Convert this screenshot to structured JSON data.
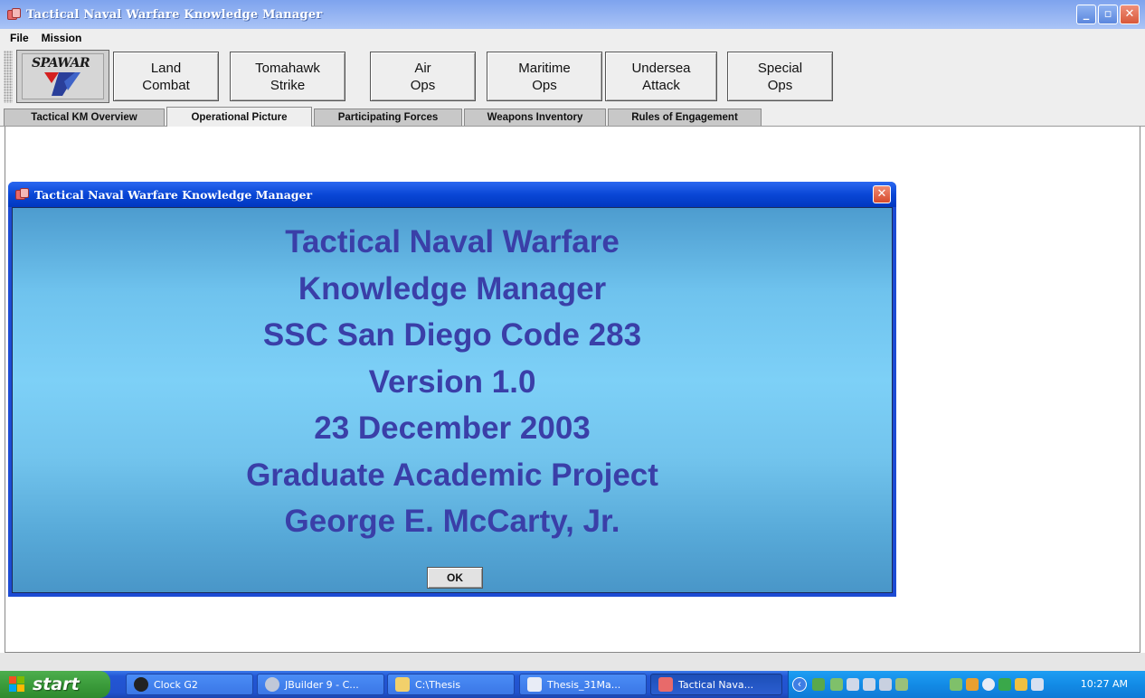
{
  "window": {
    "title": "Tactical Naval Warfare Knowledge Manager",
    "minimize": "_",
    "maximize": "▫",
    "close": "✕"
  },
  "menu": [
    "File",
    "Mission"
  ],
  "toolbar": {
    "logo_text": "SPAWAR",
    "buttons": [
      "Land\nCombat",
      "Tomahawk\nStrike",
      "Air\nOps",
      "Maritime\nOps",
      "Undersea\nAttack",
      "Special\nOps"
    ]
  },
  "tabs": [
    "Tactical KM Overview",
    "Operational Picture",
    "Participating Forces",
    "Weapons Inventory",
    "Rules of Engagement"
  ],
  "active_tab": "Operational Picture",
  "dialog": {
    "title": "Tactical Naval Warfare Knowledge Manager",
    "close": "✕",
    "lines": [
      "Tactical Naval Warfare",
      "Knowledge Manager",
      "SSC San Diego Code 283",
      "Version 1.0",
      "23 December 2003",
      "Graduate Academic Project",
      "George E. McCarty, Jr."
    ],
    "ok_label": "OK"
  },
  "taskbar": {
    "start_label": "start",
    "tasks": [
      "Clock G2",
      "JBuilder 9 - C...",
      "C:\\Thesis",
      "Thesis_31Ma...",
      "Tactical Nava..."
    ],
    "clock": "10:27 AM"
  },
  "colors": {
    "dialog_text": "#3a3fa8",
    "title_bar": "#0a47d6",
    "taskbar": "#2356d4"
  }
}
